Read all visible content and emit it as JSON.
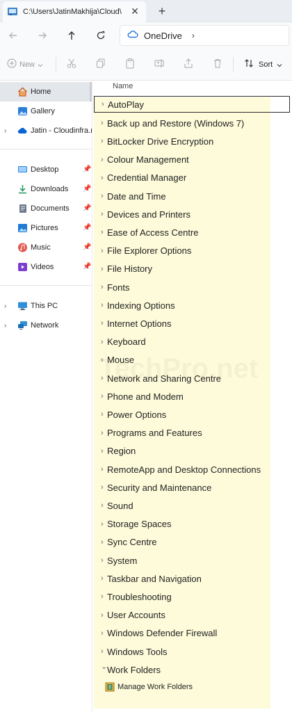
{
  "window": {
    "tab_title": "C:\\Users\\JatinMakhija\\Cloud\\",
    "close_glyph": "✕",
    "new_tab_glyph": "+"
  },
  "address_bar": {
    "location": "OneDrive",
    "separator": "›"
  },
  "command_bar": {
    "new_label": "New",
    "sort_label": "Sort"
  },
  "sidebar": {
    "items": [
      {
        "label": "Home",
        "icon": "home-icon"
      },
      {
        "label": "Gallery",
        "icon": "gallery-icon"
      },
      {
        "label": "Jatin - Cloudinfra.net",
        "icon": "onedrive-cloud-icon"
      },
      {
        "label": "Desktop",
        "icon": "desktop-icon"
      },
      {
        "label": "Downloads",
        "icon": "downloads-icon"
      },
      {
        "label": "Documents",
        "icon": "documents-icon"
      },
      {
        "label": "Pictures",
        "icon": "pictures-icon"
      },
      {
        "label": "Music",
        "icon": "music-icon"
      },
      {
        "label": "Videos",
        "icon": "videos-icon"
      },
      {
        "label": "This PC",
        "icon": "this-pc-icon"
      },
      {
        "label": "Network",
        "icon": "network-icon"
      }
    ]
  },
  "main": {
    "column_header": "Name",
    "watermark": "TechPro.net",
    "items": [
      "AutoPlay",
      "Back up and Restore (Windows 7)",
      "BitLocker Drive Encryption",
      "Colour Management",
      "Credential Manager",
      "Date and Time",
      "Devices and Printers",
      "Ease of Access Centre",
      "File Explorer Options",
      "File History",
      "Fonts",
      "Indexing Options",
      "Internet Options",
      "Keyboard",
      "Mouse",
      "Network and Sharing Centre",
      "Phone and Modem",
      "Power Options",
      "Programs and Features",
      "Region",
      "RemoteApp and Desktop Connections",
      "Security and Maintenance",
      "Sound",
      "Storage Spaces",
      "Sync Centre",
      "System",
      "Taskbar and Navigation",
      "Troubleshooting",
      "User Accounts",
      "Windows Defender Firewall",
      "Windows Tools",
      "Work Folders"
    ],
    "expanded_child": "Manage Work Folders"
  },
  "colors": {
    "highlight_background": "#fdfbda",
    "sidebar_selected": "#e3e6ea",
    "onedrive_blue": "#0a64d8"
  }
}
